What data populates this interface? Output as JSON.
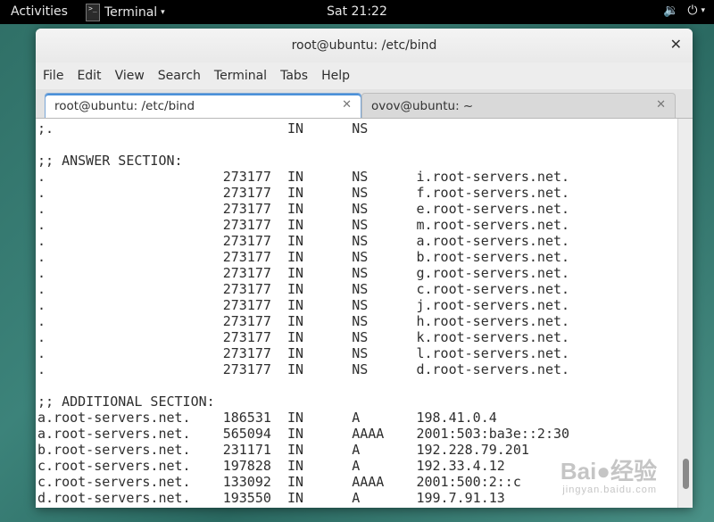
{
  "topbar": {
    "activities": "Activities",
    "app_name": "Terminal",
    "app_icon_text": ">_",
    "caret": "▾",
    "clock": "Sat 21:22",
    "volume_icon": "🔉",
    "power_icon": "⏻",
    "power_caret": "▾"
  },
  "window": {
    "title": "root@ubuntu: /etc/bind",
    "close_glyph": "✕"
  },
  "menu": [
    "File",
    "Edit",
    "View",
    "Search",
    "Terminal",
    "Tabs",
    "Help"
  ],
  "tabs": [
    {
      "label": "root@ubuntu: /etc/bind",
      "close": "✕"
    },
    {
      "label": "ovov@ubuntu: ~",
      "close": "✕"
    }
  ],
  "terminal_lines": [
    ";.                             IN      NS",
    "",
    ";; ANSWER SECTION:",
    ".                      273177  IN      NS      i.root-servers.net.",
    ".                      273177  IN      NS      f.root-servers.net.",
    ".                      273177  IN      NS      e.root-servers.net.",
    ".                      273177  IN      NS      m.root-servers.net.",
    ".                      273177  IN      NS      a.root-servers.net.",
    ".                      273177  IN      NS      b.root-servers.net.",
    ".                      273177  IN      NS      g.root-servers.net.",
    ".                      273177  IN      NS      c.root-servers.net.",
    ".                      273177  IN      NS      j.root-servers.net.",
    ".                      273177  IN      NS      h.root-servers.net.",
    ".                      273177  IN      NS      k.root-servers.net.",
    ".                      273177  IN      NS      l.root-servers.net.",
    ".                      273177  IN      NS      d.root-servers.net.",
    "",
    ";; ADDITIONAL SECTION:",
    "a.root-servers.net.    186531  IN      A       198.41.0.4",
    "a.root-servers.net.    565094  IN      AAAA    2001:503:ba3e::2:30",
    "b.root-servers.net.    231171  IN      A       192.228.79.201",
    "c.root-servers.net.    197828  IN      A       192.33.4.12",
    "c.root-servers.net.    133092  IN      AAAA    2001:500:2::c",
    "d.root-servers.net.    193550  IN      A       199.7.91.13"
  ],
  "watermark": {
    "text": "Bai●经验",
    "sub": "jingyan.baidu.com"
  }
}
